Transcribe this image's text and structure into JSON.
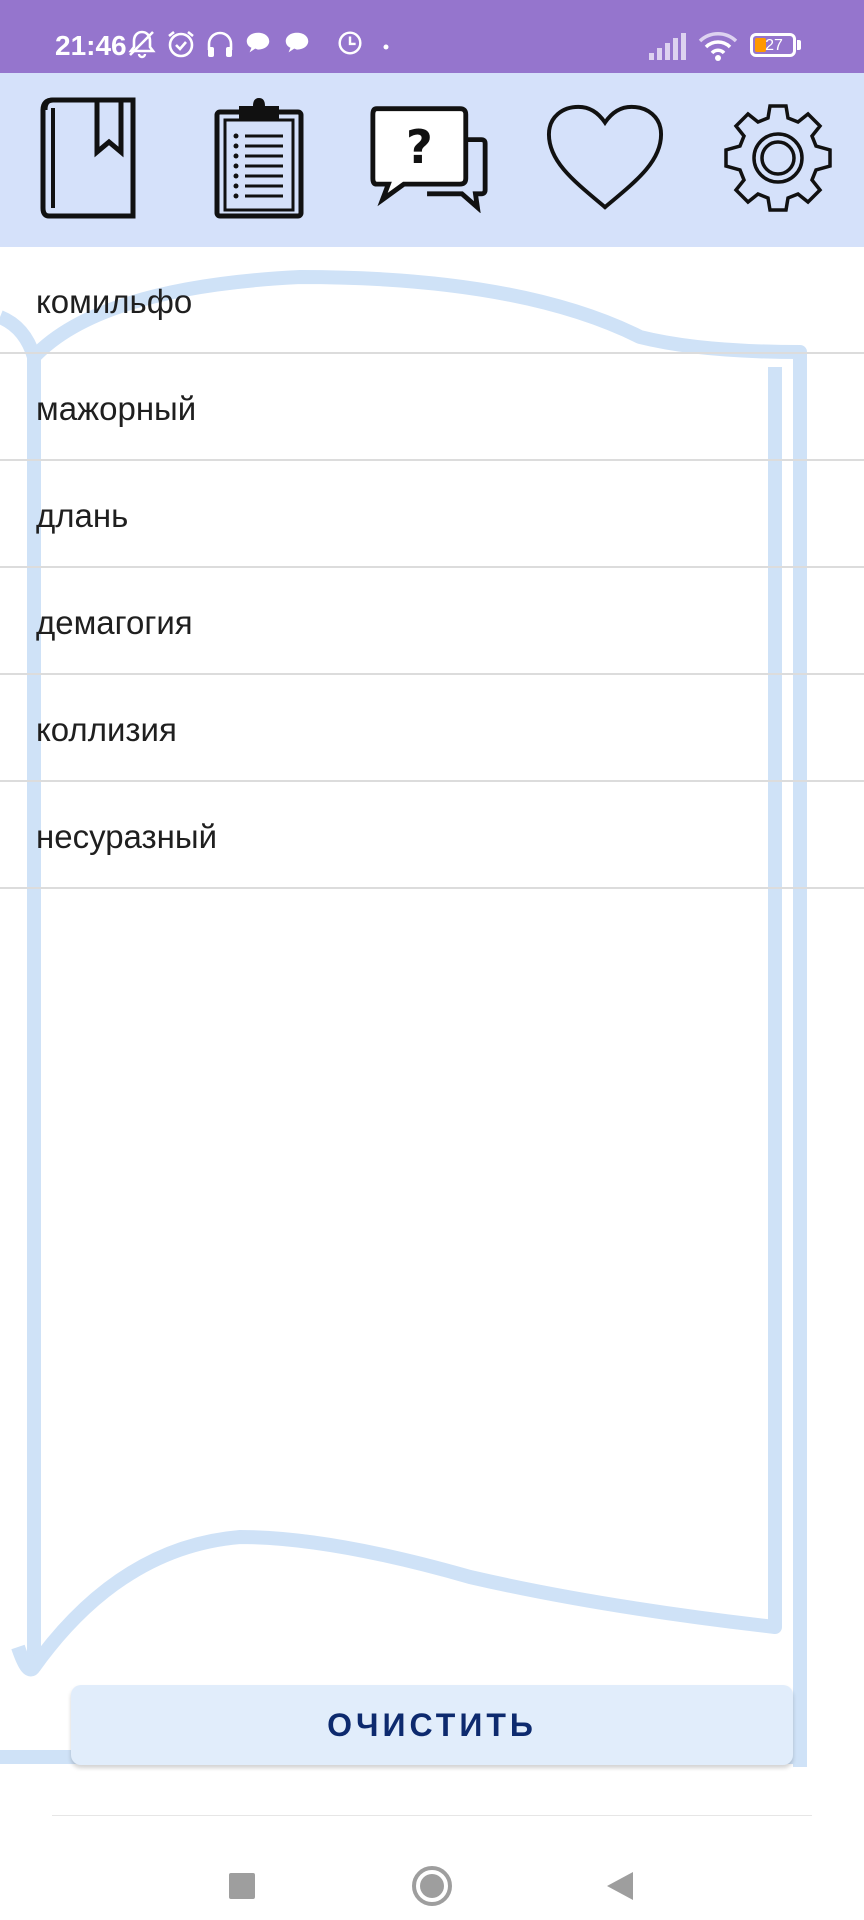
{
  "status_bar": {
    "time": "21:46",
    "battery": "27",
    "icons": [
      "mute-icon",
      "alarm-icon",
      "headphones-icon",
      "chat-icon",
      "chat-icon",
      "clock-icon",
      "dot-icon",
      "signal-icon",
      "wifi-icon",
      "battery-icon"
    ],
    "background": "#9575cd"
  },
  "toolbar": {
    "background": "#d5e1fa",
    "buttons": [
      "bookmark-book-icon",
      "clipboard-list-icon",
      "question-chat-icon",
      "heart-icon",
      "gear-icon"
    ]
  },
  "words": [
    "комильфо",
    "мажорный",
    "длань",
    "демагогия",
    "коллизия",
    "несуразный"
  ],
  "clear_button": {
    "label": "ОЧИСТИТЬ"
  },
  "nav_bar": {
    "buttons": [
      "recents-icon",
      "home-icon",
      "back-icon"
    ]
  }
}
